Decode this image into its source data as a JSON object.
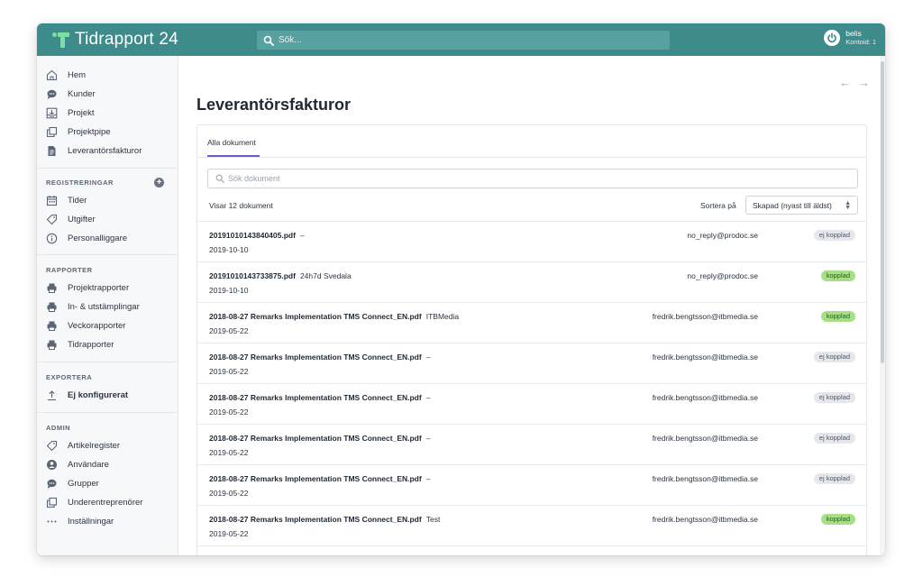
{
  "app": {
    "name": "Tidrapport 24"
  },
  "topbar": {
    "search_placeholder": "Sök...",
    "user_name": "belis",
    "user_account": "Kontoid: 1"
  },
  "sidebar": {
    "main": [
      {
        "label": "Hem",
        "icon": "home-icon"
      },
      {
        "label": "Kunder",
        "icon": "chat-icon"
      },
      {
        "label": "Projekt",
        "icon": "inbox-icon"
      },
      {
        "label": "Projektpipe",
        "icon": "copy-icon"
      },
      {
        "label": "Leverantörsfakturor",
        "icon": "document-icon"
      }
    ],
    "registreringar": {
      "heading": "REGISTRERINGAR",
      "items": [
        {
          "label": "Tider",
          "icon": "calendar-icon"
        },
        {
          "label": "Utgifter",
          "icon": "tag-icon"
        },
        {
          "label": "Personalliggare",
          "icon": "info-icon"
        }
      ]
    },
    "rapporter": {
      "heading": "RAPPORTER",
      "items": [
        {
          "label": "Projektrapporter",
          "icon": "printer-icon"
        },
        {
          "label": "In- & utstämplingar",
          "icon": "printer-icon"
        },
        {
          "label": "Veckorapporter",
          "icon": "printer-icon"
        },
        {
          "label": "Tidrapporter",
          "icon": "printer-icon"
        }
      ]
    },
    "exportera": {
      "heading": "EXPORTERA",
      "items": [
        {
          "label": "Ej konfigurerat",
          "icon": "upload-icon"
        }
      ]
    },
    "admin": {
      "heading": "ADMIN",
      "items": [
        {
          "label": "Artikelregister",
          "icon": "tag-icon"
        },
        {
          "label": "Användare",
          "icon": "user-icon"
        },
        {
          "label": "Grupper",
          "icon": "chat-icon"
        },
        {
          "label": "Underentreprenörer",
          "icon": "copy-icon"
        },
        {
          "label": "Inställningar",
          "icon": "more-icon"
        }
      ]
    }
  },
  "main": {
    "title": "Leverantörsfakturor",
    "nav_back": "←",
    "nav_forward": "→",
    "tab": "Alla dokument",
    "search_placeholder": "Sök dokument",
    "count": "Visar 12 dokument",
    "sort_label": "Sortera på",
    "sort_value": "Skapad (nyast till äldst)",
    "documents": [
      {
        "file": "20191010143840405.pdf",
        "note": "–",
        "date": "2019-10-10",
        "email": "no_reply@prodoc.se",
        "status": "ej kopplad",
        "linked": false
      },
      {
        "file": "20191010143733875.pdf",
        "note": "24h7d Svedala",
        "date": "2019-10-10",
        "email": "no_reply@prodoc.se",
        "status": "kopplad",
        "linked": true
      },
      {
        "file": "2018-08-27 Remarks Implementation TMS Connect_EN.pdf",
        "note": "ITBMedia",
        "date": "2019-05-22",
        "email": "fredrik.bengtsson@itbmedia.se",
        "status": "kopplad",
        "linked": true
      },
      {
        "file": "2018-08-27 Remarks Implementation TMS Connect_EN.pdf",
        "note": "–",
        "date": "2019-05-22",
        "email": "fredrik.bengtsson@itbmedia.se",
        "status": "ej kopplad",
        "linked": false
      },
      {
        "file": "2018-08-27 Remarks Implementation TMS Connect_EN.pdf",
        "note": "–",
        "date": "2019-05-22",
        "email": "fredrik.bengtsson@itbmedia.se",
        "status": "ej kopplad",
        "linked": false
      },
      {
        "file": "2018-08-27 Remarks Implementation TMS Connect_EN.pdf",
        "note": "–",
        "date": "2019-05-22",
        "email": "fredrik.bengtsson@itbmedia.se",
        "status": "ej kopplad",
        "linked": false
      },
      {
        "file": "2018-08-27 Remarks Implementation TMS Connect_EN.pdf",
        "note": "–",
        "date": "2019-05-22",
        "email": "fredrik.bengtsson@itbmedia.se",
        "status": "ej kopplad",
        "linked": false
      },
      {
        "file": "2018-08-27 Remarks Implementation TMS Connect_EN.pdf",
        "note": "Test",
        "date": "2019-05-22",
        "email": "fredrik.bengtsson@itbmedia.se",
        "status": "kopplad",
        "linked": true
      }
    ]
  },
  "colors": {
    "topbar": "#3e8b8b",
    "accent": "#6c5ec4",
    "badge_linked": "#a6df85",
    "badge_unlinked": "#e4e7eb"
  }
}
